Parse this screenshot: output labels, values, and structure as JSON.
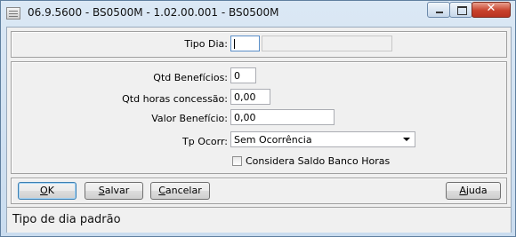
{
  "window": {
    "title": "06.9.5600 - BS0500M - 1.02.00.001 - BS0500M",
    "close_glyph": "✕"
  },
  "form": {
    "tipo_dia": {
      "label": "Tipo Dia:",
      "code_value": "",
      "desc_value": ""
    },
    "qtd_beneficios": {
      "label": "Qtd Benefícios:",
      "value": "0"
    },
    "qtd_horas_concessao": {
      "label": "Qtd horas concessão:",
      "value": "0,00"
    },
    "valor_beneficio": {
      "label": "Valor Benefício:",
      "value": "0,00"
    },
    "tp_ocorr": {
      "label": "Tp Ocorr:",
      "selected": "Sem Ocorrência"
    },
    "considera_saldo": {
      "label": "Considera Saldo Banco Horas",
      "checked": false
    }
  },
  "buttons": {
    "ok_first": "O",
    "ok_rest": "K",
    "salvar_first": "S",
    "salvar_rest": "alvar",
    "cancelar_first": "C",
    "cancelar_rest": "ancelar",
    "ajuda_first": "A",
    "ajuda_rest": "juda"
  },
  "status_bar": {
    "text": "Tipo de dia padrão"
  }
}
